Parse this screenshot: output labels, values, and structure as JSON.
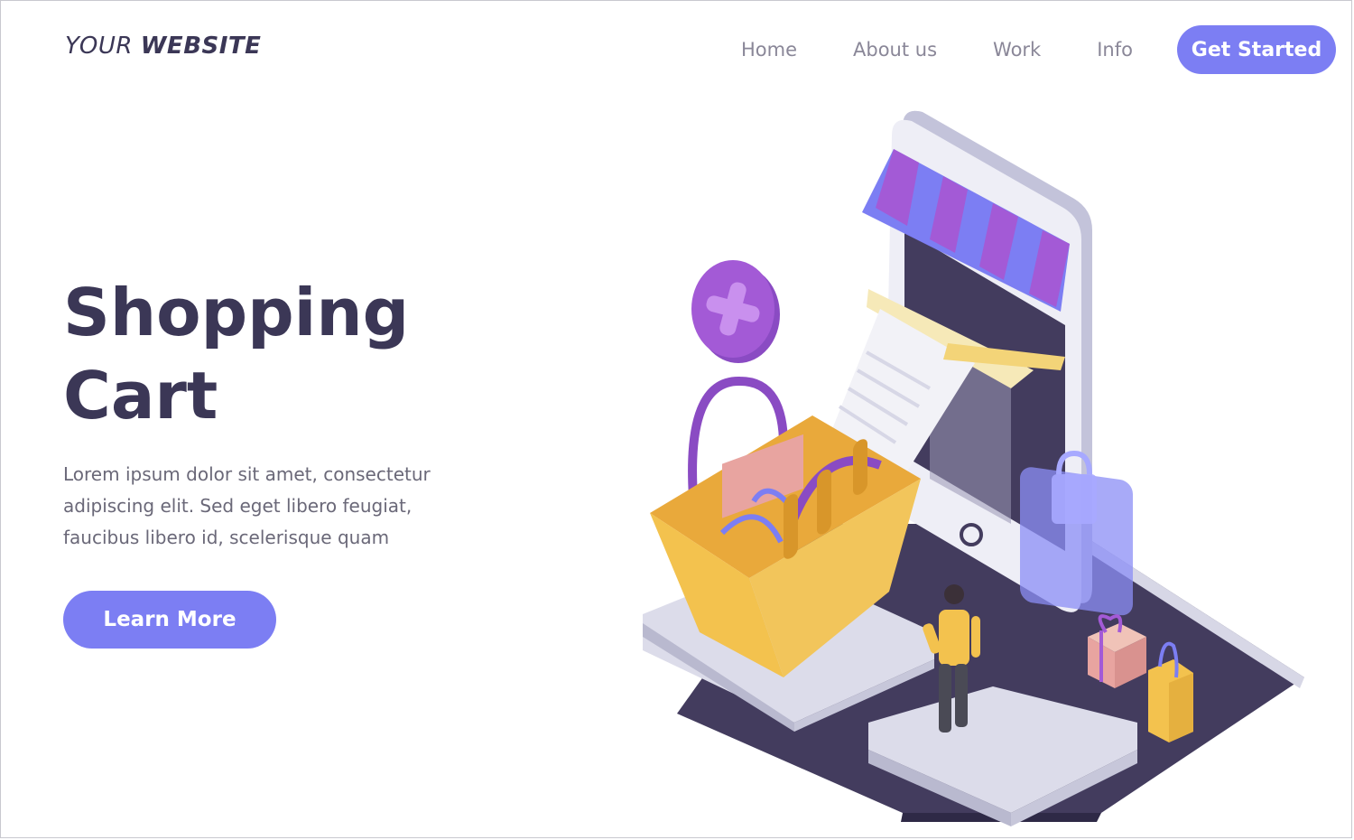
{
  "header": {
    "logo_light": "YOUR ",
    "logo_bold": "WEBSITE",
    "nav": [
      "Home",
      "About us",
      "Work",
      "Info"
    ],
    "cta_label": "Get Started"
  },
  "hero": {
    "title_line1": "Shopping",
    "title_line2": "Cart",
    "description": "Lorem ipsum dolor sit amet, consectetur adipiscing elit. Sed eget libero feugiat, faucibus libero id, scelerisque quam",
    "button_label": "Learn More"
  },
  "colors": {
    "accent": "#7c7ef3",
    "heading": "#3b3756",
    "body_text": "#6a6878",
    "nav_text": "#8a8798"
  },
  "illustration": {
    "icons": [
      "smartphone-icon",
      "shopping-basket-icon",
      "plus-badge-icon",
      "gift-box-icon",
      "shopping-bag-icon",
      "padlock-card-icon",
      "person-figure"
    ]
  }
}
